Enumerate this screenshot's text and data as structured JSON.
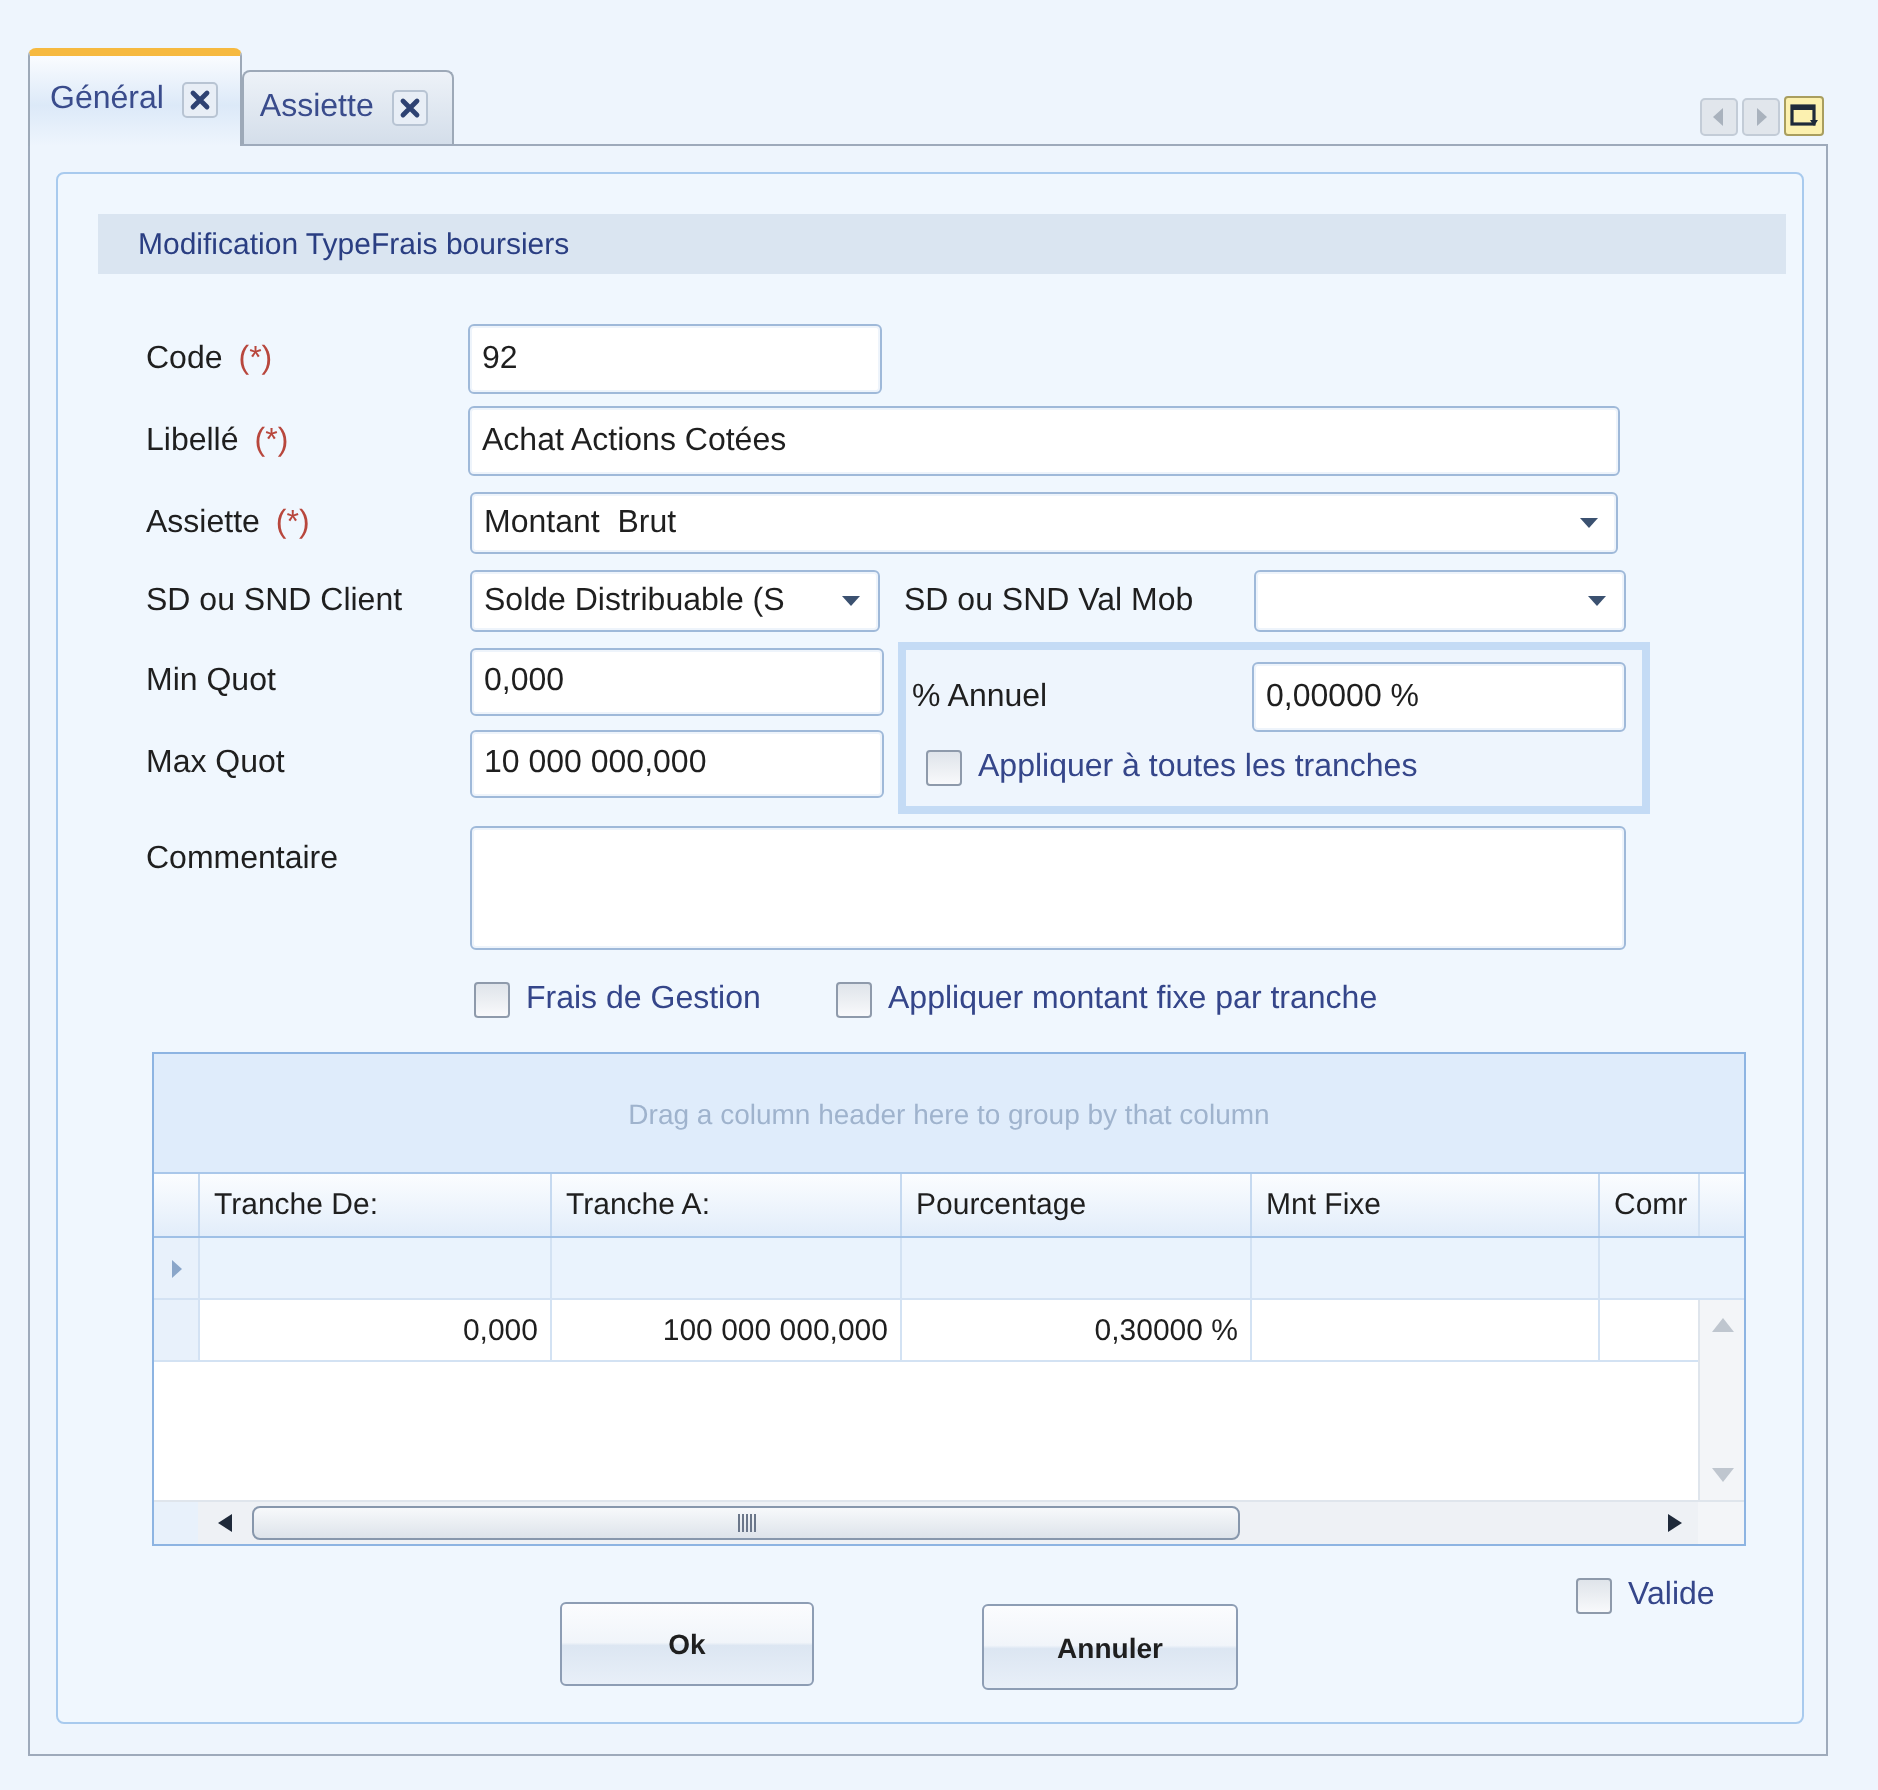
{
  "tabs": [
    {
      "label": "Général",
      "selected": true
    },
    {
      "label": "Assiette",
      "selected": false
    }
  ],
  "tab_nav": {
    "back_disabled": true,
    "forward_disabled": true
  },
  "panel": {
    "title": "Modification TypeFrais boursiers"
  },
  "form": {
    "code": {
      "label": "Code",
      "required_mark": "(*)",
      "value": "92"
    },
    "libelle": {
      "label": "Libellé",
      "required_mark": "(*)",
      "value": "Achat Actions Cotées"
    },
    "assiette": {
      "label": "Assiette",
      "required_mark": "(*)",
      "value": "Montant  Brut"
    },
    "sd_client": {
      "label": "SD ou SND Client",
      "value": "Solde Distribuable (S"
    },
    "sd_val_mob": {
      "label": "SD ou SND Val Mob"
    },
    "min_quot": {
      "label": "Min Quot",
      "value": "0,000"
    },
    "max_quot": {
      "label": "Max Quot",
      "value": "10 000 000,000"
    },
    "annuel": {
      "label": "% Annuel",
      "value": "0,00000 %"
    },
    "apply_all": {
      "label": "Appliquer à toutes les tranches",
      "checked": false
    },
    "commentaire": {
      "label": "Commentaire"
    },
    "frais_gestion": {
      "label": "Frais de Gestion",
      "checked": false
    },
    "montant_fixe": {
      "label": "Appliquer montant fixe par tranche",
      "checked": false
    }
  },
  "grid": {
    "group_hint": "Drag a column header here to group by that column",
    "columns": [
      "Tranche De:",
      "Tranche A:",
      "Pourcentage",
      "Mnt Fixe",
      "Comr"
    ],
    "rows": [
      {
        "kind": "new",
        "selected": true
      },
      {
        "kind": "data",
        "selected": false,
        "cells": [
          "0,000",
          "100 000 000,000",
          "0,30000 %"
        ]
      }
    ]
  },
  "buttons": [
    {
      "label": "Ok"
    },
    {
      "label": "Annuler"
    }
  ],
  "valide": {
    "label": "Valide",
    "checked": false
  }
}
